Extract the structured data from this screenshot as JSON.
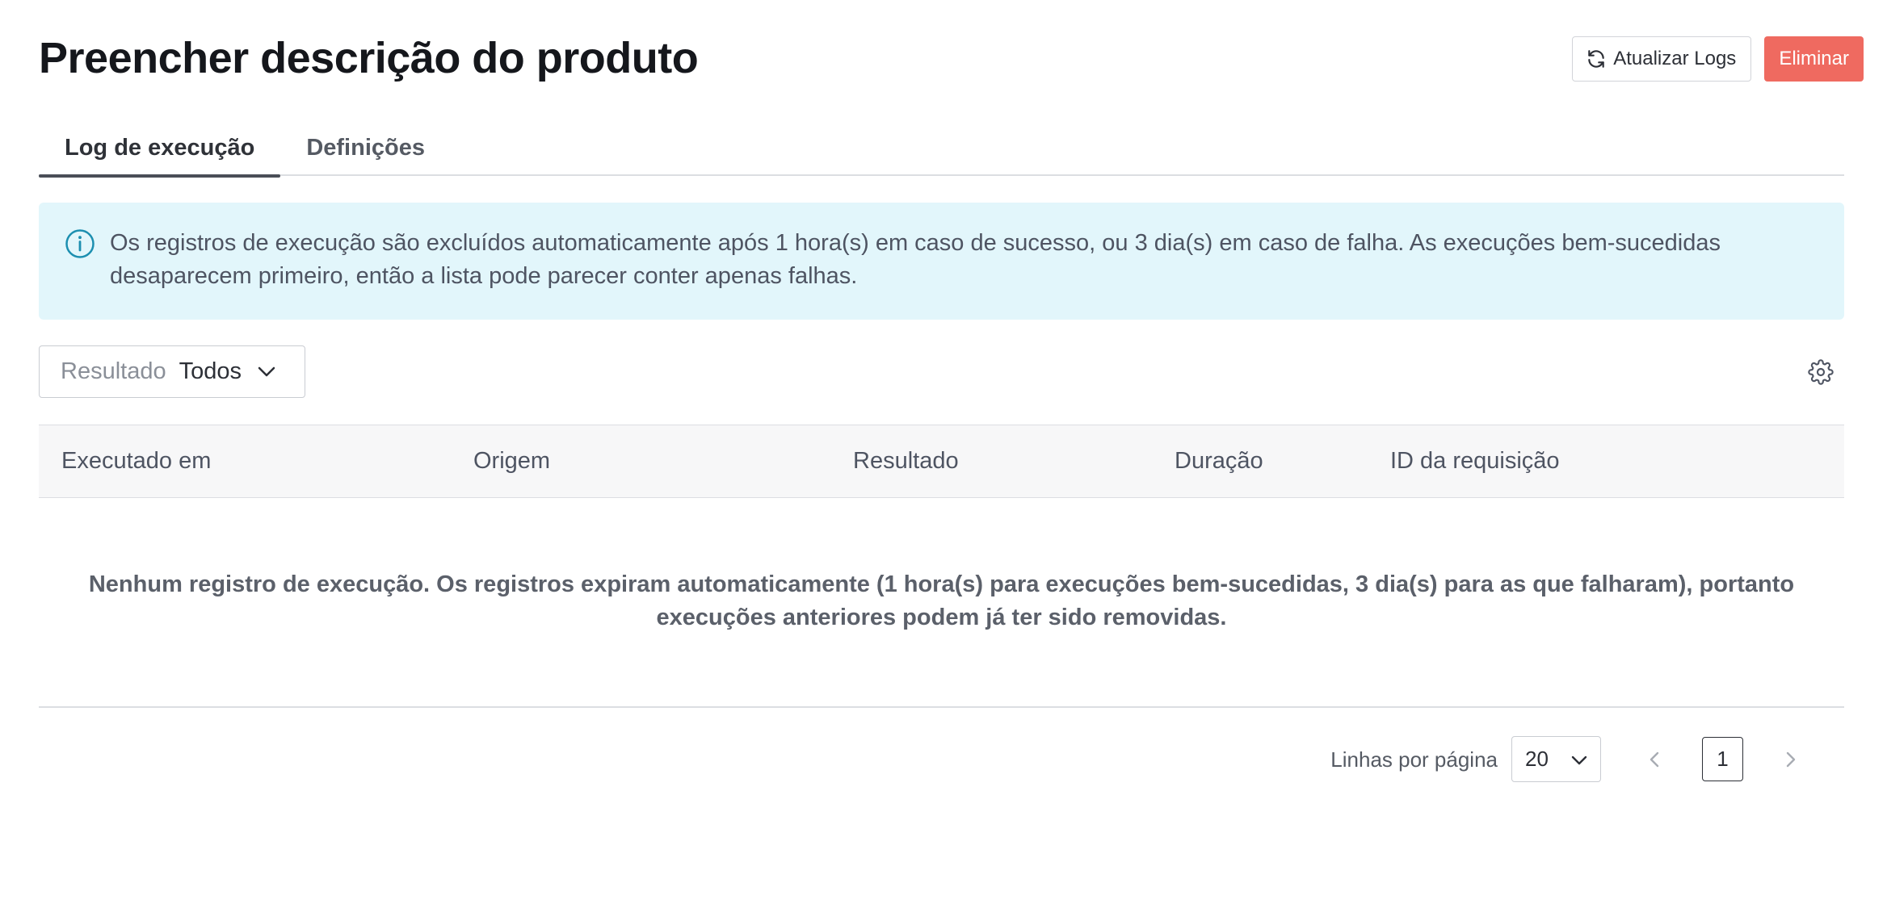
{
  "header": {
    "title": "Preencher descrição do produto",
    "refresh_label": "Atualizar Logs",
    "delete_label": "Eliminar",
    "danger_color": "#ef6a60"
  },
  "tabs": [
    {
      "label": "Log de execução",
      "active": true
    },
    {
      "label": "Definições",
      "active": false
    }
  ],
  "info_banner": {
    "icon": "info-icon",
    "text": "Os registros de execução são excluídos automaticamente após 1 hora(s) em caso de sucesso, ou 3 dia(s) em caso de falha. As execuções bem-sucedidas desaparecem primeiro, então a lista pode parecer conter apenas falhas.",
    "background": "#e2f6fb"
  },
  "filter": {
    "label": "Resultado",
    "value": "Todos"
  },
  "table": {
    "columns": [
      "Executado em",
      "Origem",
      "Resultado",
      "Duração",
      "ID da requisição"
    ],
    "rows": [],
    "empty_message": "Nenhum registro de execução. Os registros expiram automaticamente (1 hora(s) para execuções bem-sucedidas, 3 dia(s) para as que falharam), portanto execuções anteriores podem já ter sido removidas."
  },
  "pagination": {
    "rows_per_page_label": "Linhas por página",
    "rows_per_page": "20",
    "current_page": "1"
  }
}
